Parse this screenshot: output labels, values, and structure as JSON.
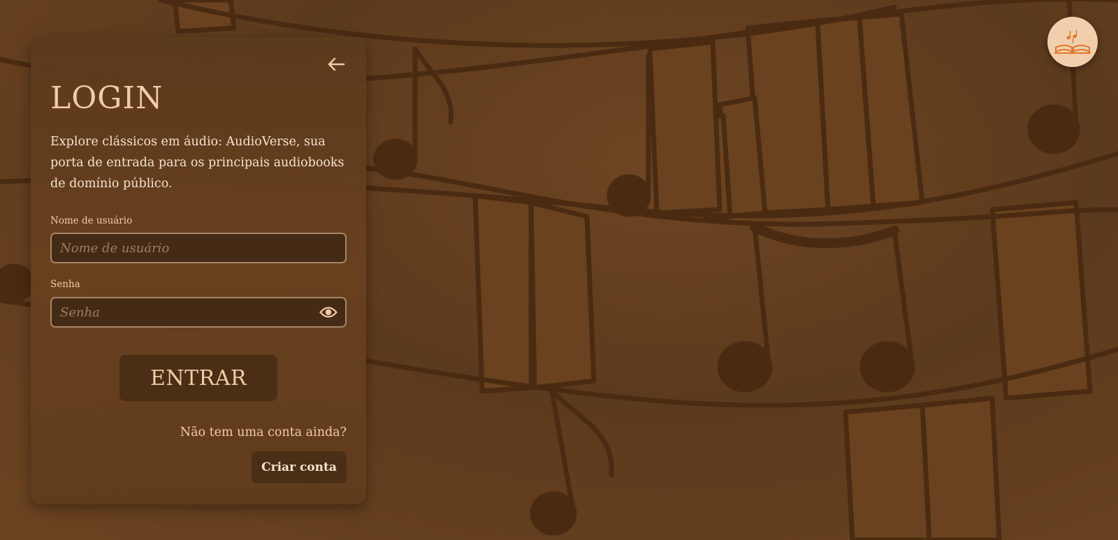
{
  "colors": {
    "card_bg": "#5f3b1d",
    "accent": "#f3cba6",
    "button_bg": "#4a2e15",
    "input_bg": "#452b16",
    "input_border": "#a88566",
    "logo_badge": "#f1cfad"
  },
  "header": {
    "logo_icon": "open-book-music-icon"
  },
  "login": {
    "back_icon": "arrow-left-icon",
    "title": "LOGIN",
    "description": "Explore clássicos em áudio: AudioVerse, sua porta de entrada para os principais audiobooks de domínio público.",
    "username": {
      "label": "Nome de usuário",
      "placeholder": "Nome de usuário",
      "value": ""
    },
    "password": {
      "label": "Senha",
      "placeholder": "Senha",
      "value": "",
      "toggle_icon": "eye-icon"
    },
    "submit_label": "ENTRAR",
    "no_account_text": "Não tem uma conta ainda?",
    "create_account_label": "Criar conta"
  }
}
